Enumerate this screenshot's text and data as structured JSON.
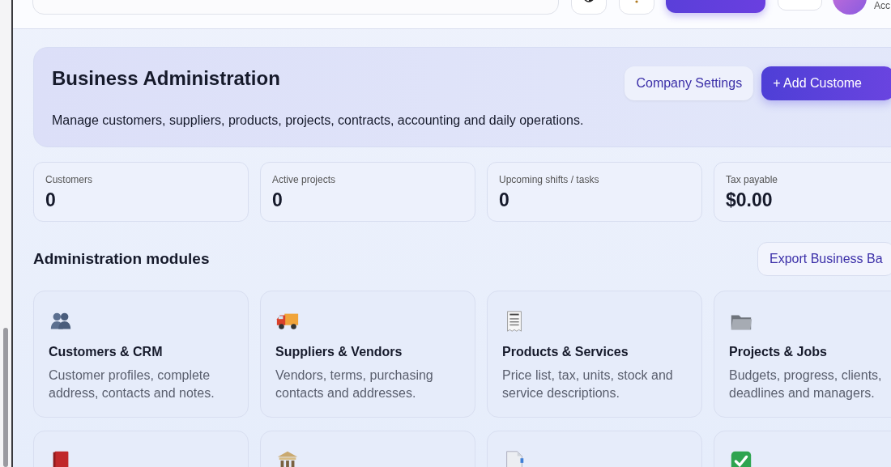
{
  "top_bar": {
    "account_label": "Acc"
  },
  "hero": {
    "title": "Business Administration",
    "subtitle": "Manage customers, suppliers, products, projects, contracts, accounting and daily operations.",
    "buttons": [
      {
        "label": "Company Settings",
        "kind": "secondary"
      },
      {
        "label": "+ Add Custome",
        "kind": "primary"
      }
    ]
  },
  "stats": [
    {
      "label": "Customers",
      "value": "0"
    },
    {
      "label": "Active projects",
      "value": "0"
    },
    {
      "label": "Upcoming shifts / tasks",
      "value": "0"
    },
    {
      "label": "Tax payable",
      "value": "$0.00"
    }
  ],
  "modules_section": {
    "title": "Administration modules",
    "export_button": "Export Business Ba"
  },
  "modules": [
    {
      "kind": "people",
      "title": "Customers & CRM",
      "description": "Customer profiles, complete address, contacts and notes."
    },
    {
      "kind": "truck",
      "title": "Suppliers & Vendors",
      "description": "Vendors, terms, purchasing contacts and addresses."
    },
    {
      "kind": "receipt",
      "title": "Products & Services",
      "description": "Price list, tax, units, stock and service descriptions."
    },
    {
      "kind": "folder",
      "title": "Projects & Jobs",
      "description": "Budgets, progress, clients, deadlines and managers."
    },
    {
      "kind": "book"
    },
    {
      "kind": "bank"
    },
    {
      "kind": "document"
    },
    {
      "kind": "check"
    }
  ]
}
